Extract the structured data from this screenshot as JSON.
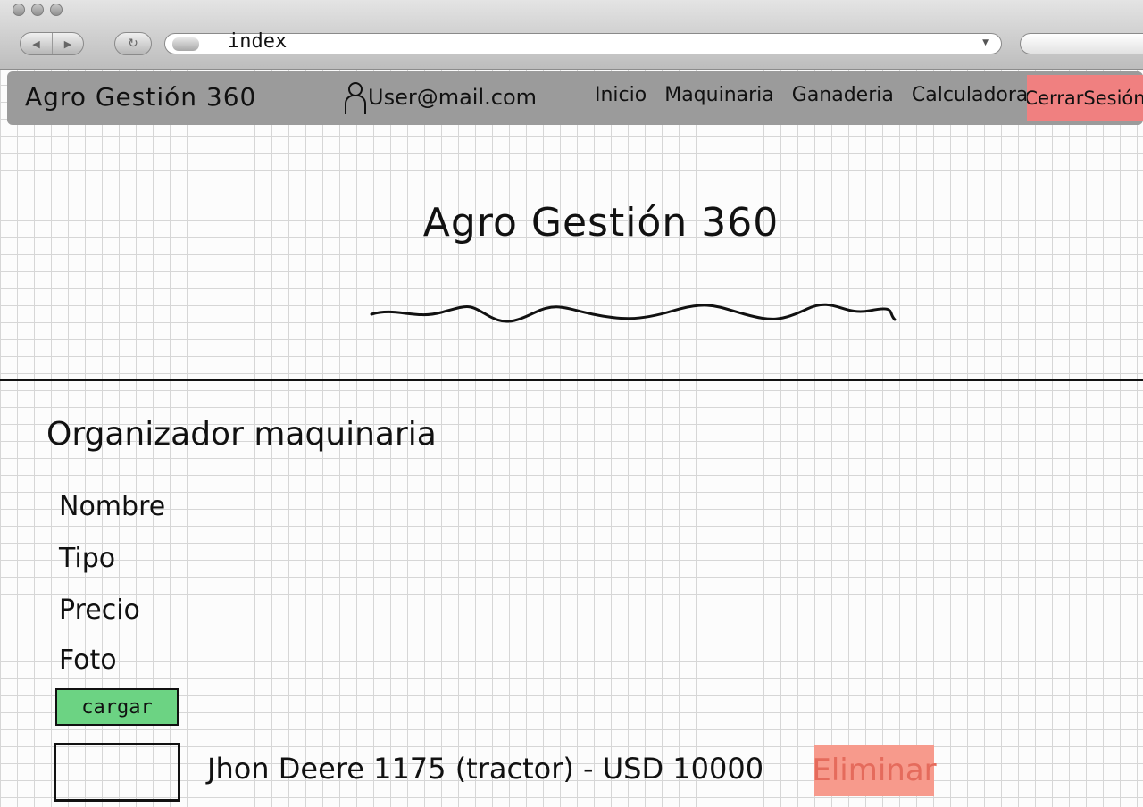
{
  "browser": {
    "url": "index"
  },
  "navbar": {
    "brand": "Agro Gestión 360",
    "user_email": "User@mail.com",
    "links": [
      "Inicio",
      "Maquinaria",
      "Ganaderia",
      "Calculadora"
    ],
    "logout_label": "CerrarSesión"
  },
  "hero": {
    "title": "Agro Gestión 360"
  },
  "section": {
    "title": "Organizador maquinaria",
    "fields": [
      "Nombre",
      "Tipo",
      "Precio",
      "Foto"
    ],
    "load_label": "cargar"
  },
  "items": [
    {
      "text": "Jhon Deere 1175 (tractor) - USD 10000",
      "delete_label": "Eliminar"
    }
  ],
  "colors": {
    "navbar_bg": "#9b9b9b",
    "logout_bg": "#f08080",
    "load_btn_bg": "#6cd383",
    "delete_btn_bg": "#f79a8c"
  }
}
